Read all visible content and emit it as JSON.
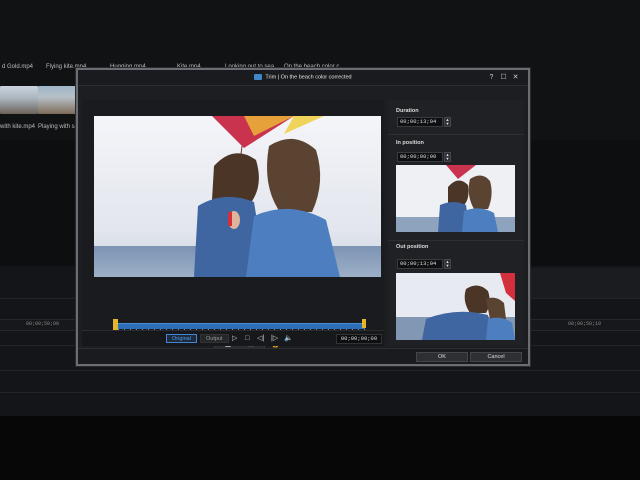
{
  "library": {
    "items": [
      {
        "label": "d Gold.mp4"
      },
      {
        "label": "Flying kite.mp4"
      },
      {
        "label": "Hugging.mp4"
      },
      {
        "label": "Kite.mp4"
      },
      {
        "label": "Looking out to sea"
      },
      {
        "label": "On the beach color c"
      }
    ],
    "thumb_items": [
      {
        "label": "with kite.mp4"
      },
      {
        "label": "Playing with sar"
      }
    ]
  },
  "timeline": {
    "time_left": "00;00;50;00",
    "time_right": "00;00;50;10"
  },
  "dialog": {
    "title": "Trim | On the beach color corrected",
    "help_label": "?",
    "maximize_label": "☐",
    "close_label": "✕",
    "duration_label": "Duration",
    "duration_value": "00;00;13;04",
    "in_position_label": "In position",
    "in_position_value": "00;00;00;00",
    "out_position_label": "Out position",
    "out_position_value": "00;00;13;04",
    "original_label": "Original",
    "output_label": "Output",
    "current_time": "00;00;00;00",
    "ok_label": "OK",
    "cancel_label": "Cancel",
    "trim_progress": 0.0
  },
  "icons": {
    "play": "▷",
    "stop": "□",
    "prev_frame": "◁|",
    "next_frame": "|▷",
    "volume": "🔈",
    "lock": "🔒",
    "spin_up": "▲",
    "spin_down": "▼",
    "mark_in": "⬓",
    "mark_out": "⬒"
  },
  "colors": {
    "accent": "#3f86d6",
    "trim_handle": "#e4b42a",
    "trim_bar": "#2d6eb8"
  }
}
